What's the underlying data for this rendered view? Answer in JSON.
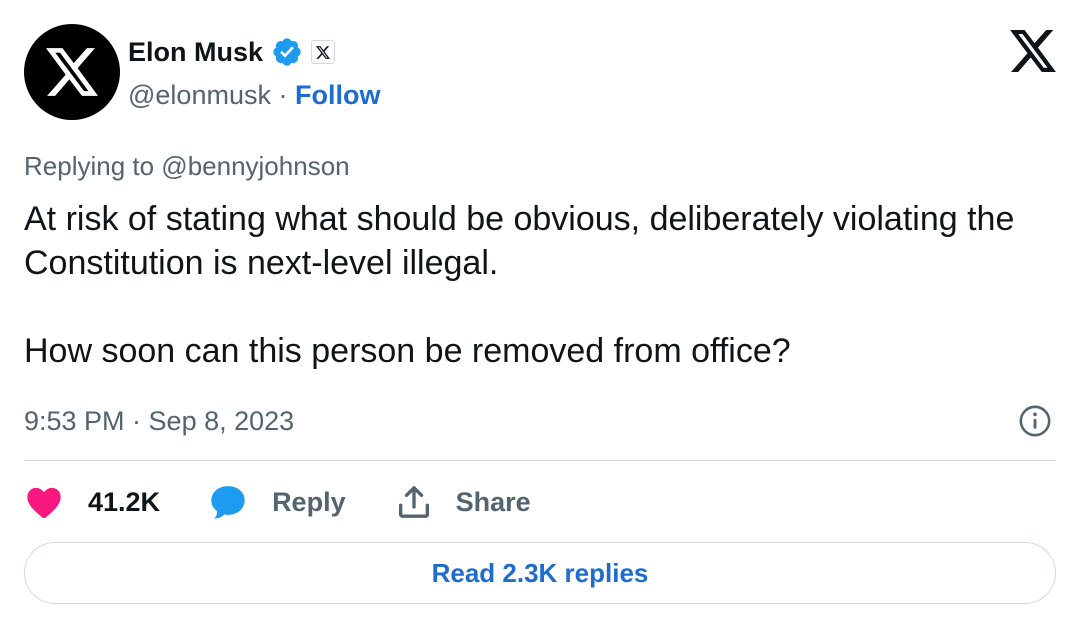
{
  "author": {
    "name": "Elon Musk",
    "handle": "@elonmusk",
    "separator": " · ",
    "follow_label": "Follow",
    "avatar_icon": "x-logo-icon",
    "verified_icon": "verified-badge-icon",
    "affiliate_icon": "x-affiliate-badge-icon"
  },
  "header": {
    "logo_icon": "x-logo-icon"
  },
  "tweet": {
    "replying_to": "Replying to @bennyjohnson",
    "paragraphs": [
      "At risk of stating what should be obvious, deliberately violating the Constitution is next-level illegal.",
      "How soon can this person be removed from office?"
    ],
    "timestamp": "9:53 PM · Sep 8, 2023",
    "info_icon": "info-icon"
  },
  "actions": {
    "like_count": "41.2K",
    "reply_label": "Reply",
    "share_label": "Share",
    "like_icon": "heart-icon",
    "reply_icon": "speech-bubble-icon",
    "share_icon": "share-icon"
  },
  "footer": {
    "read_replies_label": "Read 2.3K replies"
  },
  "colors": {
    "link_blue": "#1d6ccf",
    "verified_blue": "#1d9bf0",
    "like_pink": "#f91880",
    "text_primary": "#0f1419",
    "text_secondary": "#536471",
    "border": "#cfd9de"
  }
}
